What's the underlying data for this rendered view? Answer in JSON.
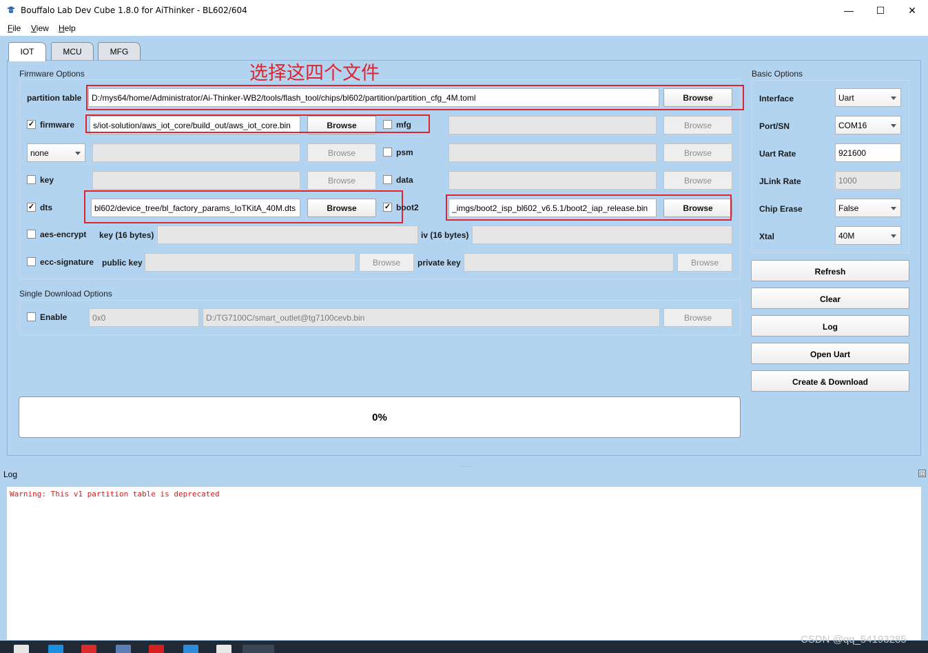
{
  "window": {
    "title": "Bouffalo Lab Dev Cube 1.8.0 for AiThinker - BL602/604",
    "controls": {
      "minimize": "—",
      "maximize": "☐",
      "close": "✕"
    }
  },
  "menu": {
    "items": [
      {
        "label": "File",
        "mnemonic": "F",
        "rest": "ile"
      },
      {
        "label": "View",
        "mnemonic": "V",
        "rest": "iew"
      },
      {
        "label": "Help",
        "mnemonic": "H",
        "rest": "elp"
      }
    ]
  },
  "tabs": [
    {
      "label": "IOT",
      "active": true
    },
    {
      "label": "MCU",
      "active": false
    },
    {
      "label": "MFG",
      "active": false
    }
  ],
  "annotation": "选择这四个文件",
  "firmware_options": {
    "title": "Firmware Options",
    "partition_table": {
      "label": "partition table",
      "value": "D:/mys64/home/Administrator/Ai-Thinker-WB2/tools/flash_tool/chips/bl602/partition/partition_cfg_4M.toml",
      "browse": "Browse"
    },
    "firmware": {
      "checked": true,
      "label": "firmware",
      "value": "s/iot-solution/aws_iot_core/build_out/aws_iot_core.bin",
      "browse": "Browse"
    },
    "mfg": {
      "checked": false,
      "label": "mfg",
      "value": "",
      "browse": "Browse"
    },
    "none_select": {
      "value": "none",
      "field": "",
      "browse": "Browse"
    },
    "psm": {
      "checked": false,
      "label": "psm",
      "value": "",
      "browse": "Browse"
    },
    "key": {
      "checked": false,
      "label": "key",
      "value": "",
      "browse": "Browse"
    },
    "data": {
      "checked": false,
      "label": "data",
      "value": "",
      "browse": "Browse"
    },
    "dts": {
      "checked": true,
      "label": "dts",
      "value": "bl602/device_tree/bl_factory_params_IoTKitA_40M.dts",
      "browse": "Browse"
    },
    "boot2": {
      "checked": true,
      "label": "boot2",
      "value": "_imgs/boot2_isp_bl602_v6.5.1/boot2_iap_release.bin",
      "browse": "Browse"
    },
    "aes_encrypt": {
      "checked": false,
      "label": "aes-encrypt",
      "key_label": "key (16 bytes)",
      "key_value": "",
      "iv_label": "iv (16 bytes)",
      "iv_value": ""
    },
    "ecc_signature": {
      "checked": false,
      "label": "ecc-signature",
      "public_key_label": "public key",
      "public_key_value": "",
      "public_browse": "Browse",
      "private_key_label": "private key",
      "private_key_value": "",
      "private_browse": "Browse"
    }
  },
  "single_download": {
    "title": "Single Download Options",
    "enable_checked": false,
    "enable_label": "Enable",
    "address": "0x0",
    "file": "D:/TG7100C/smart_outlet@tg7100cevb.bin",
    "browse": "Browse"
  },
  "basic_options": {
    "title": "Basic Options",
    "interface": {
      "label": "Interface",
      "value": "Uart"
    },
    "port": {
      "label": "Port/SN",
      "value": "COM16"
    },
    "uart_rate": {
      "label": "Uart Rate",
      "value": "921600"
    },
    "jlink_rate": {
      "label": "JLink Rate",
      "value": "1000"
    },
    "chip_erase": {
      "label": "Chip Erase",
      "value": "False"
    },
    "xtal": {
      "label": "Xtal",
      "value": "40M"
    }
  },
  "actions": {
    "refresh": "Refresh",
    "clear": "Clear",
    "log": "Log",
    "open_uart": "Open Uart",
    "create_download": "Create & Download"
  },
  "progress": {
    "text": "0%",
    "fraction": 0.0
  },
  "splitter": "......",
  "log": {
    "title": "Log",
    "lines": [
      "Warning: This v1 partition table is deprecated"
    ]
  },
  "watermark": "CSDN @qq_54193285",
  "colors": {
    "window_bg": "#b3d4f0",
    "annotation_red": "#e0242e",
    "log_warning": "#cc1f1f"
  }
}
